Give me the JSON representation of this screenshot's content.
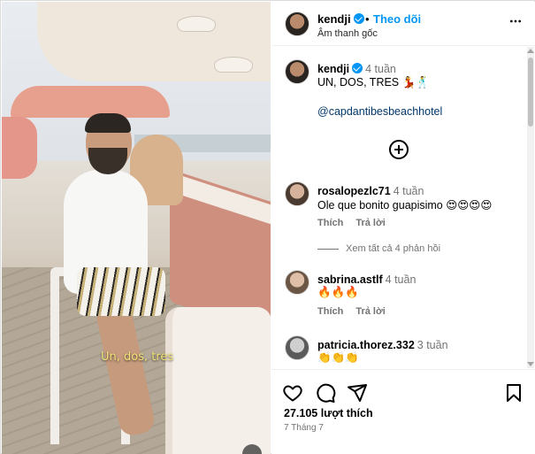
{
  "post": {
    "username": "kendji",
    "follow_label": "Theo dõi",
    "separator": "•",
    "audio": "Âm thanh gốc",
    "video_caption": "Un, dos, tres",
    "more_icon": "more-horizontal-icon"
  },
  "caption": {
    "username": "kendji",
    "time": "4 tuần",
    "text": "UN, DOS, TRES 💃🕺",
    "mention": "@capdantibesbeachhotel"
  },
  "comments": [
    {
      "username": "rosalopezlc71",
      "time": "4 tuần",
      "text": "Ole que bonito guapisimo 😍😍😍😍",
      "like_label": "Thích",
      "reply_label": "Trả lời",
      "view_replies": "Xem tất cả 4 phản hồi"
    },
    {
      "username": "sabrina.astlf",
      "time": "4 tuần",
      "text": "🔥🔥🔥",
      "like_label": "Thích",
      "reply_label": "Trả lời"
    },
    {
      "username": "patricia.thorez.332",
      "time": "3 tuần",
      "text": "👏👏👏"
    }
  ],
  "footer": {
    "likes": "27.105 lượt thích",
    "date": "7 Tháng 7"
  },
  "colors": {
    "accent": "#0095f6",
    "mention": "#00376b",
    "muted": "#737373"
  }
}
